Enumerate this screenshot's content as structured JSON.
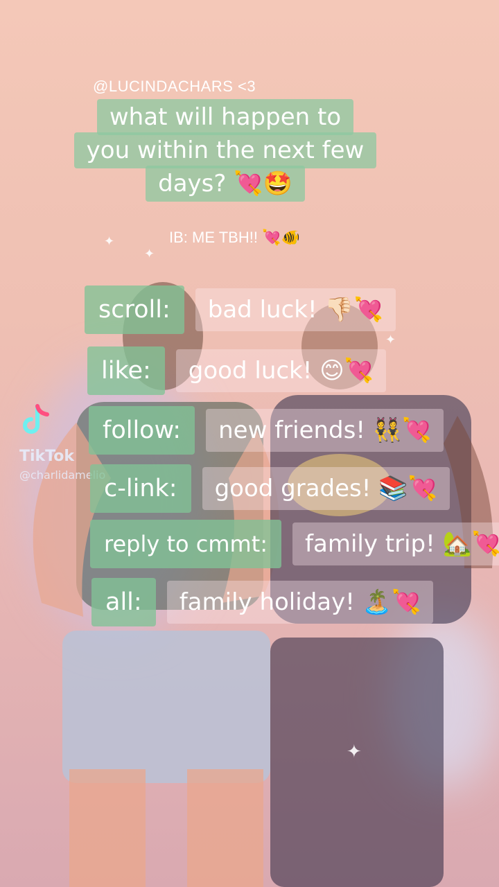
{
  "credit": "@LUCINDACHARS <3",
  "title": {
    "lines": [
      "what will happen to",
      "you within the next few",
      "days? 💘🤩"
    ]
  },
  "subtitle": "IB: ME TBH!! 💘🐠",
  "rows": [
    {
      "key": "scroll:",
      "value": "bad luck! 👎🏻💘"
    },
    {
      "key": "like:",
      "value": "good luck! 😊💘"
    },
    {
      "key": "follow:",
      "value": "new friends! 👯💘"
    },
    {
      "key": "c-link:",
      "value": "good grades! 📚💘"
    },
    {
      "key": "reply to cmmt:",
      "value": "family trip! 🏡💘"
    },
    {
      "key": "all:",
      "value": "family holiday! 🏝️💘"
    }
  ],
  "watermark": {
    "brand": "TikTok",
    "username": "@charlidamelio"
  },
  "colors": {
    "label_bg": "#82c396",
    "value_bg": "#ffebf0",
    "background": "#f0c3b5"
  }
}
